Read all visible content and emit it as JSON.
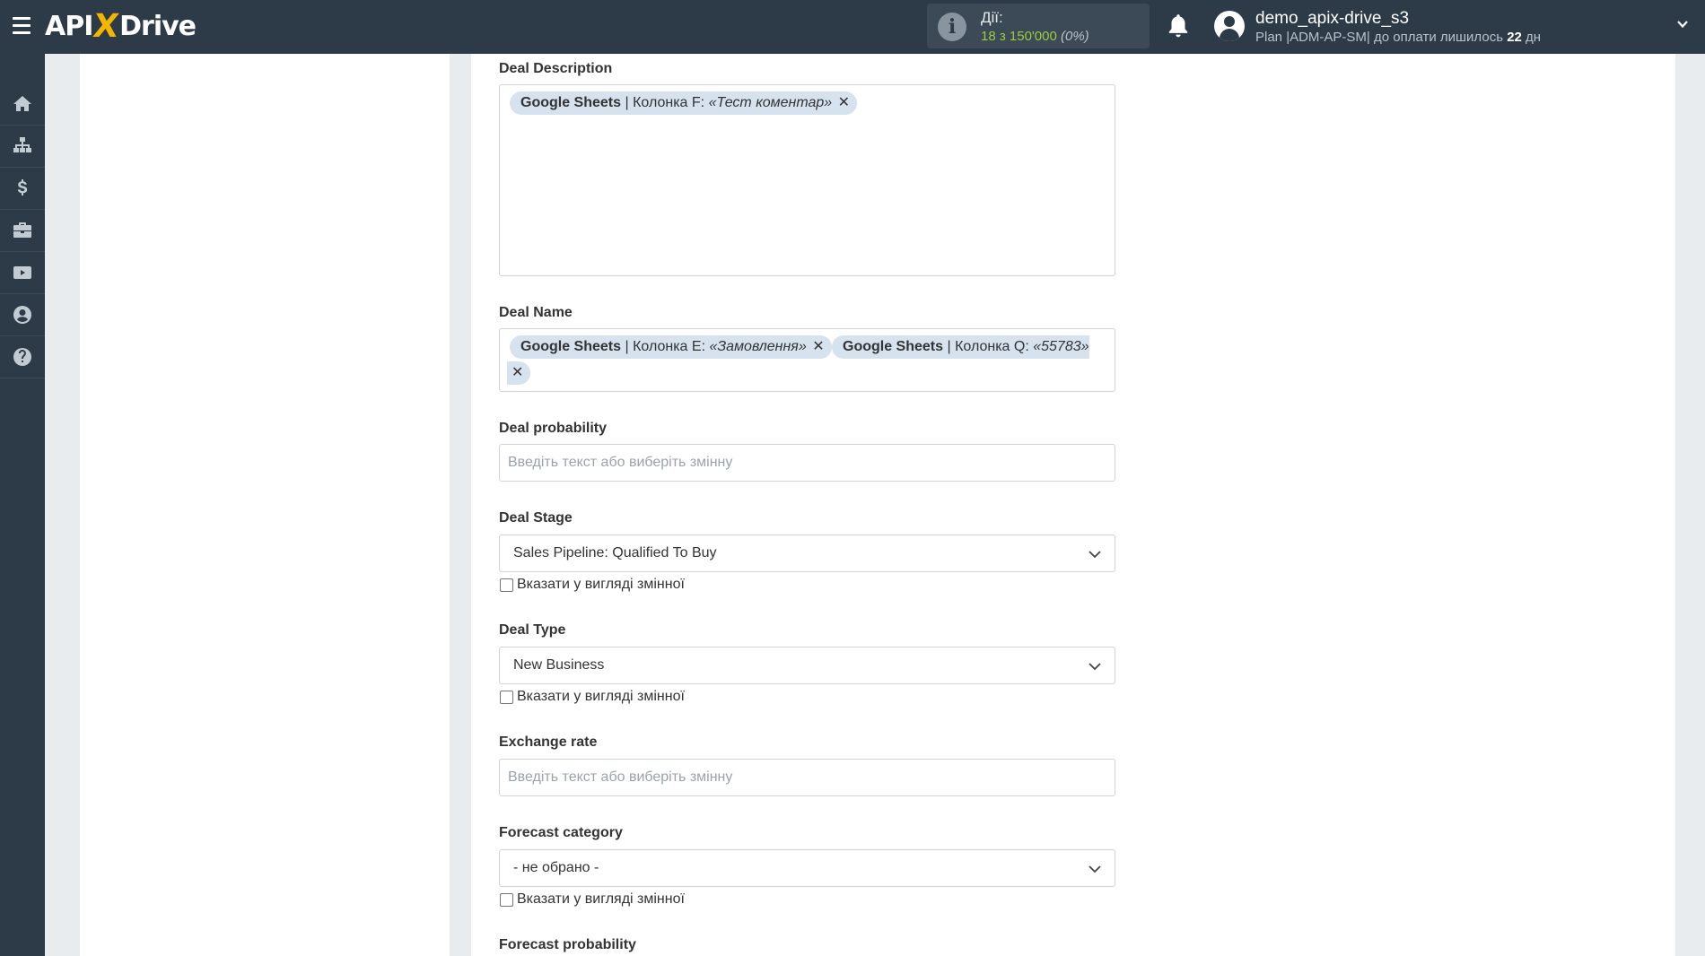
{
  "header": {
    "logo_left": "API",
    "logo_x": "X",
    "logo_right": "Drive",
    "actions_label": "Дії:",
    "actions_value": "18 з 150'000",
    "actions_pct": "(0%)",
    "username": "demo_apix-drive_s3",
    "plan_prefix": "Plan |ADM-AP-SM| до оплати лишилось ",
    "plan_days": "22",
    "plan_suffix": " дн"
  },
  "sidebar": {
    "items": [
      "home-icon",
      "sitemap-icon",
      "dollar-icon",
      "briefcase-icon",
      "video-icon",
      "user-circle-icon",
      "question-icon"
    ]
  },
  "form": {
    "deal_description": {
      "label": "Deal Description",
      "tags": [
        {
          "source": "Google Sheets",
          "column": " | Колонка F: ",
          "value": "«Тест коментар»",
          "remove": "✕"
        }
      ]
    },
    "deal_name": {
      "label": "Deal Name",
      "tags": [
        {
          "source": "Google Sheets",
          "column": " | Колонка E: ",
          "value": "«Замовлення»",
          "remove": "✕"
        },
        {
          "source": "Google Sheets",
          "column": " | Колонка Q: ",
          "value": "«55783»",
          "remove": "✕"
        }
      ]
    },
    "deal_probability": {
      "label": "Deal probability",
      "placeholder": "Введіть текст або виберіть змінну"
    },
    "deal_stage": {
      "label": "Deal Stage",
      "value": "Sales Pipeline: Qualified To Buy",
      "checkbox_label": "Вказати у вигляді змінної"
    },
    "deal_type": {
      "label": "Deal Type",
      "value": "New Business",
      "checkbox_label": "Вказати у вигляді змінної"
    },
    "exchange_rate": {
      "label": "Exchange rate",
      "placeholder": "Введіть текст або виберіть змінну"
    },
    "forecast_category": {
      "label": "Forecast category",
      "value": "- не обрано -",
      "checkbox_label": "Вказати у вигляді змінної"
    },
    "forecast_probability": {
      "label": "Forecast probability"
    }
  },
  "colors": {
    "topbar": "#2d3a47",
    "accent": "#f2b600",
    "actions_green": "#9ccc3c",
    "tag_bg": "#d6e2ee"
  }
}
